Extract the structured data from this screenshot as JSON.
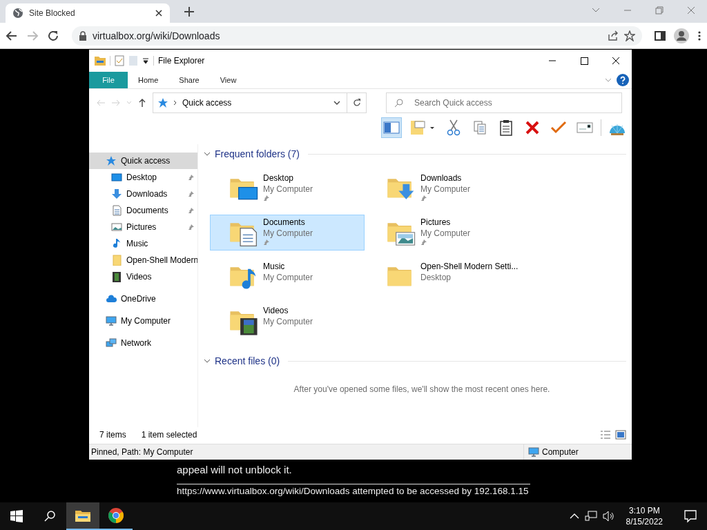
{
  "browser": {
    "tab_title": "Site Blocked",
    "url": "virtualbox.org/wiki/Downloads"
  },
  "explorer": {
    "title": "File Explorer",
    "ribbon_tabs": [
      {
        "label": "File",
        "selected": false,
        "kind": "file"
      },
      {
        "label": "Home",
        "selected": false,
        "kind": "tab"
      },
      {
        "label": "Share",
        "selected": false,
        "kind": "tab"
      },
      {
        "label": "View",
        "selected": false,
        "kind": "tab"
      }
    ],
    "address": "Quick access",
    "search": {
      "placeholder": "Search Quick access"
    },
    "nav": [
      {
        "label": "Quick access",
        "kind": "star",
        "selected": true,
        "children": [
          {
            "label": "Desktop",
            "kind": "desktop",
            "pinned": true,
            "selected": false
          },
          {
            "label": "Downloads",
            "kind": "download",
            "pinned": true,
            "selected": false
          },
          {
            "label": "Documents",
            "kind": "document",
            "pinned": true,
            "selected": false
          },
          {
            "label": "Pictures",
            "kind": "picture",
            "pinned": true,
            "selected": false
          },
          {
            "label": "Music",
            "kind": "music",
            "pinned": false,
            "selected": false
          },
          {
            "label": "Open-Shell Modern",
            "kind": "folder",
            "pinned": false,
            "selected": false
          },
          {
            "label": "Videos",
            "kind": "video",
            "pinned": false,
            "selected": false
          }
        ]
      },
      {
        "label": "OneDrive",
        "kind": "cloud",
        "selected": false
      },
      {
        "label": "My Computer",
        "kind": "computer",
        "selected": false
      },
      {
        "label": "Network",
        "kind": "network",
        "selected": false
      }
    ],
    "frequent": {
      "title": "Frequent folders (7)",
      "folders": [
        {
          "name": "Desktop",
          "location": "My Computer",
          "kind": "desktop",
          "pinned": true,
          "selected": false
        },
        {
          "name": "Downloads",
          "location": "My Computer",
          "kind": "download",
          "pinned": true,
          "selected": false
        },
        {
          "name": "Documents",
          "location": "My Computer",
          "kind": "document",
          "pinned": true,
          "selected": true
        },
        {
          "name": "Pictures",
          "location": "My Computer",
          "kind": "picture",
          "pinned": true,
          "selected": false
        },
        {
          "name": "Music",
          "location": "My Computer",
          "kind": "music",
          "pinned": false,
          "selected": false
        },
        {
          "name": "Open-Shell Modern Setti...",
          "location": "Desktop",
          "kind": "folder",
          "pinned": false,
          "selected": false
        },
        {
          "name": "Videos",
          "location": "My Computer",
          "kind": "video",
          "pinned": false,
          "selected": false
        }
      ]
    },
    "recent": {
      "title": "Recent files (0)",
      "message": "After you've opened some files, we'll show the most recent ones here."
    },
    "item_count": "7 items",
    "selection": "1 item selected",
    "status_bar": {
      "info": "Pinned, Path: My Computer",
      "zone": "Computer"
    }
  },
  "page": {
    "text": "appeal will not unblock it.",
    "footer": "https://www.virtualbox.org/wiki/Downloads attempted to be accessed by 192.168.1.15"
  },
  "taskbar": {
    "apps": [
      {
        "kind": "explorer",
        "selected": true
      },
      {
        "kind": "chrome",
        "selected": false
      }
    ],
    "time": "3:10 PM",
    "date": "8/15/2022"
  }
}
